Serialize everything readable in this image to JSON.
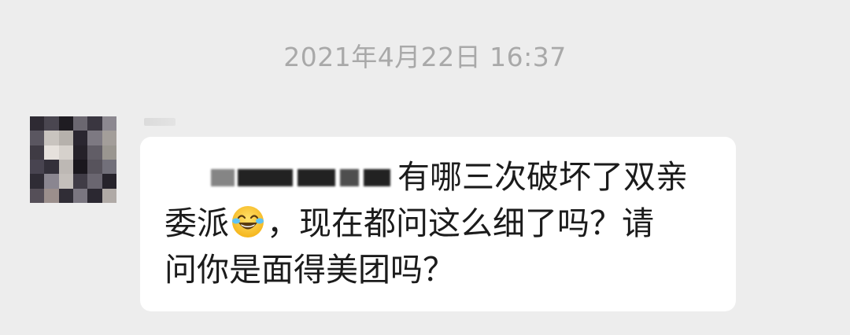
{
  "chat": {
    "timestamp": "2021年4月22日 16:37",
    "message": {
      "line1": "有哪三次破坏了双亲",
      "line2_a": "委派",
      "line2_b": "，现在都问这么细了吗？请",
      "line3": "问你是面得美团吗？",
      "emoji": "face-with-tears-of-joy-icon",
      "redacted_note": ""
    }
  },
  "colors": {
    "background": "#ededed",
    "bubble": "#ffffff",
    "timestamp_text": "#a9a9a9",
    "message_text": "#1b1b1b"
  }
}
